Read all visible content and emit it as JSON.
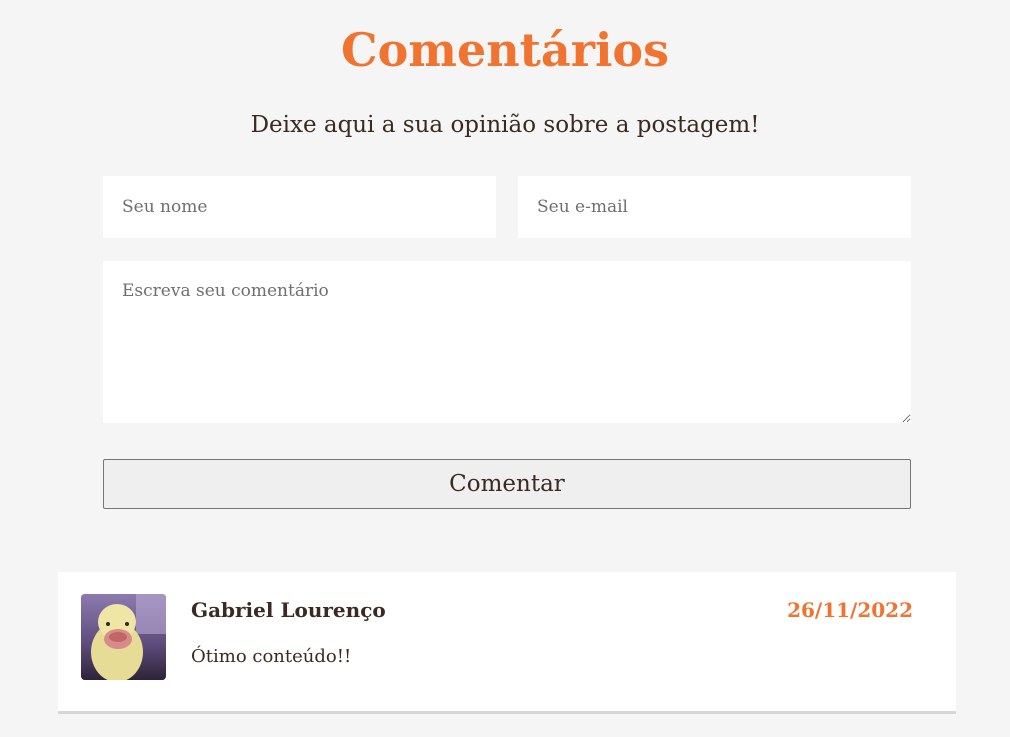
{
  "section": {
    "title": "Comentários",
    "subtitle": "Deixe aqui a sua opinião sobre a postagem!"
  },
  "form": {
    "name_placeholder": "Seu nome",
    "email_placeholder": "Seu e-mail",
    "comment_placeholder": "Escreva seu comentário",
    "submit_label": "Comentar"
  },
  "comments": [
    {
      "author": "Gabriel Lourenço",
      "date": "26/11/2022",
      "text": "Ótimo conteúdo!!",
      "avatar_icon": "user-photo-avatar"
    }
  ],
  "colors": {
    "accent": "#f07330",
    "text": "#3b2a22",
    "background": "#f5f5f5",
    "card": "#ffffff"
  }
}
